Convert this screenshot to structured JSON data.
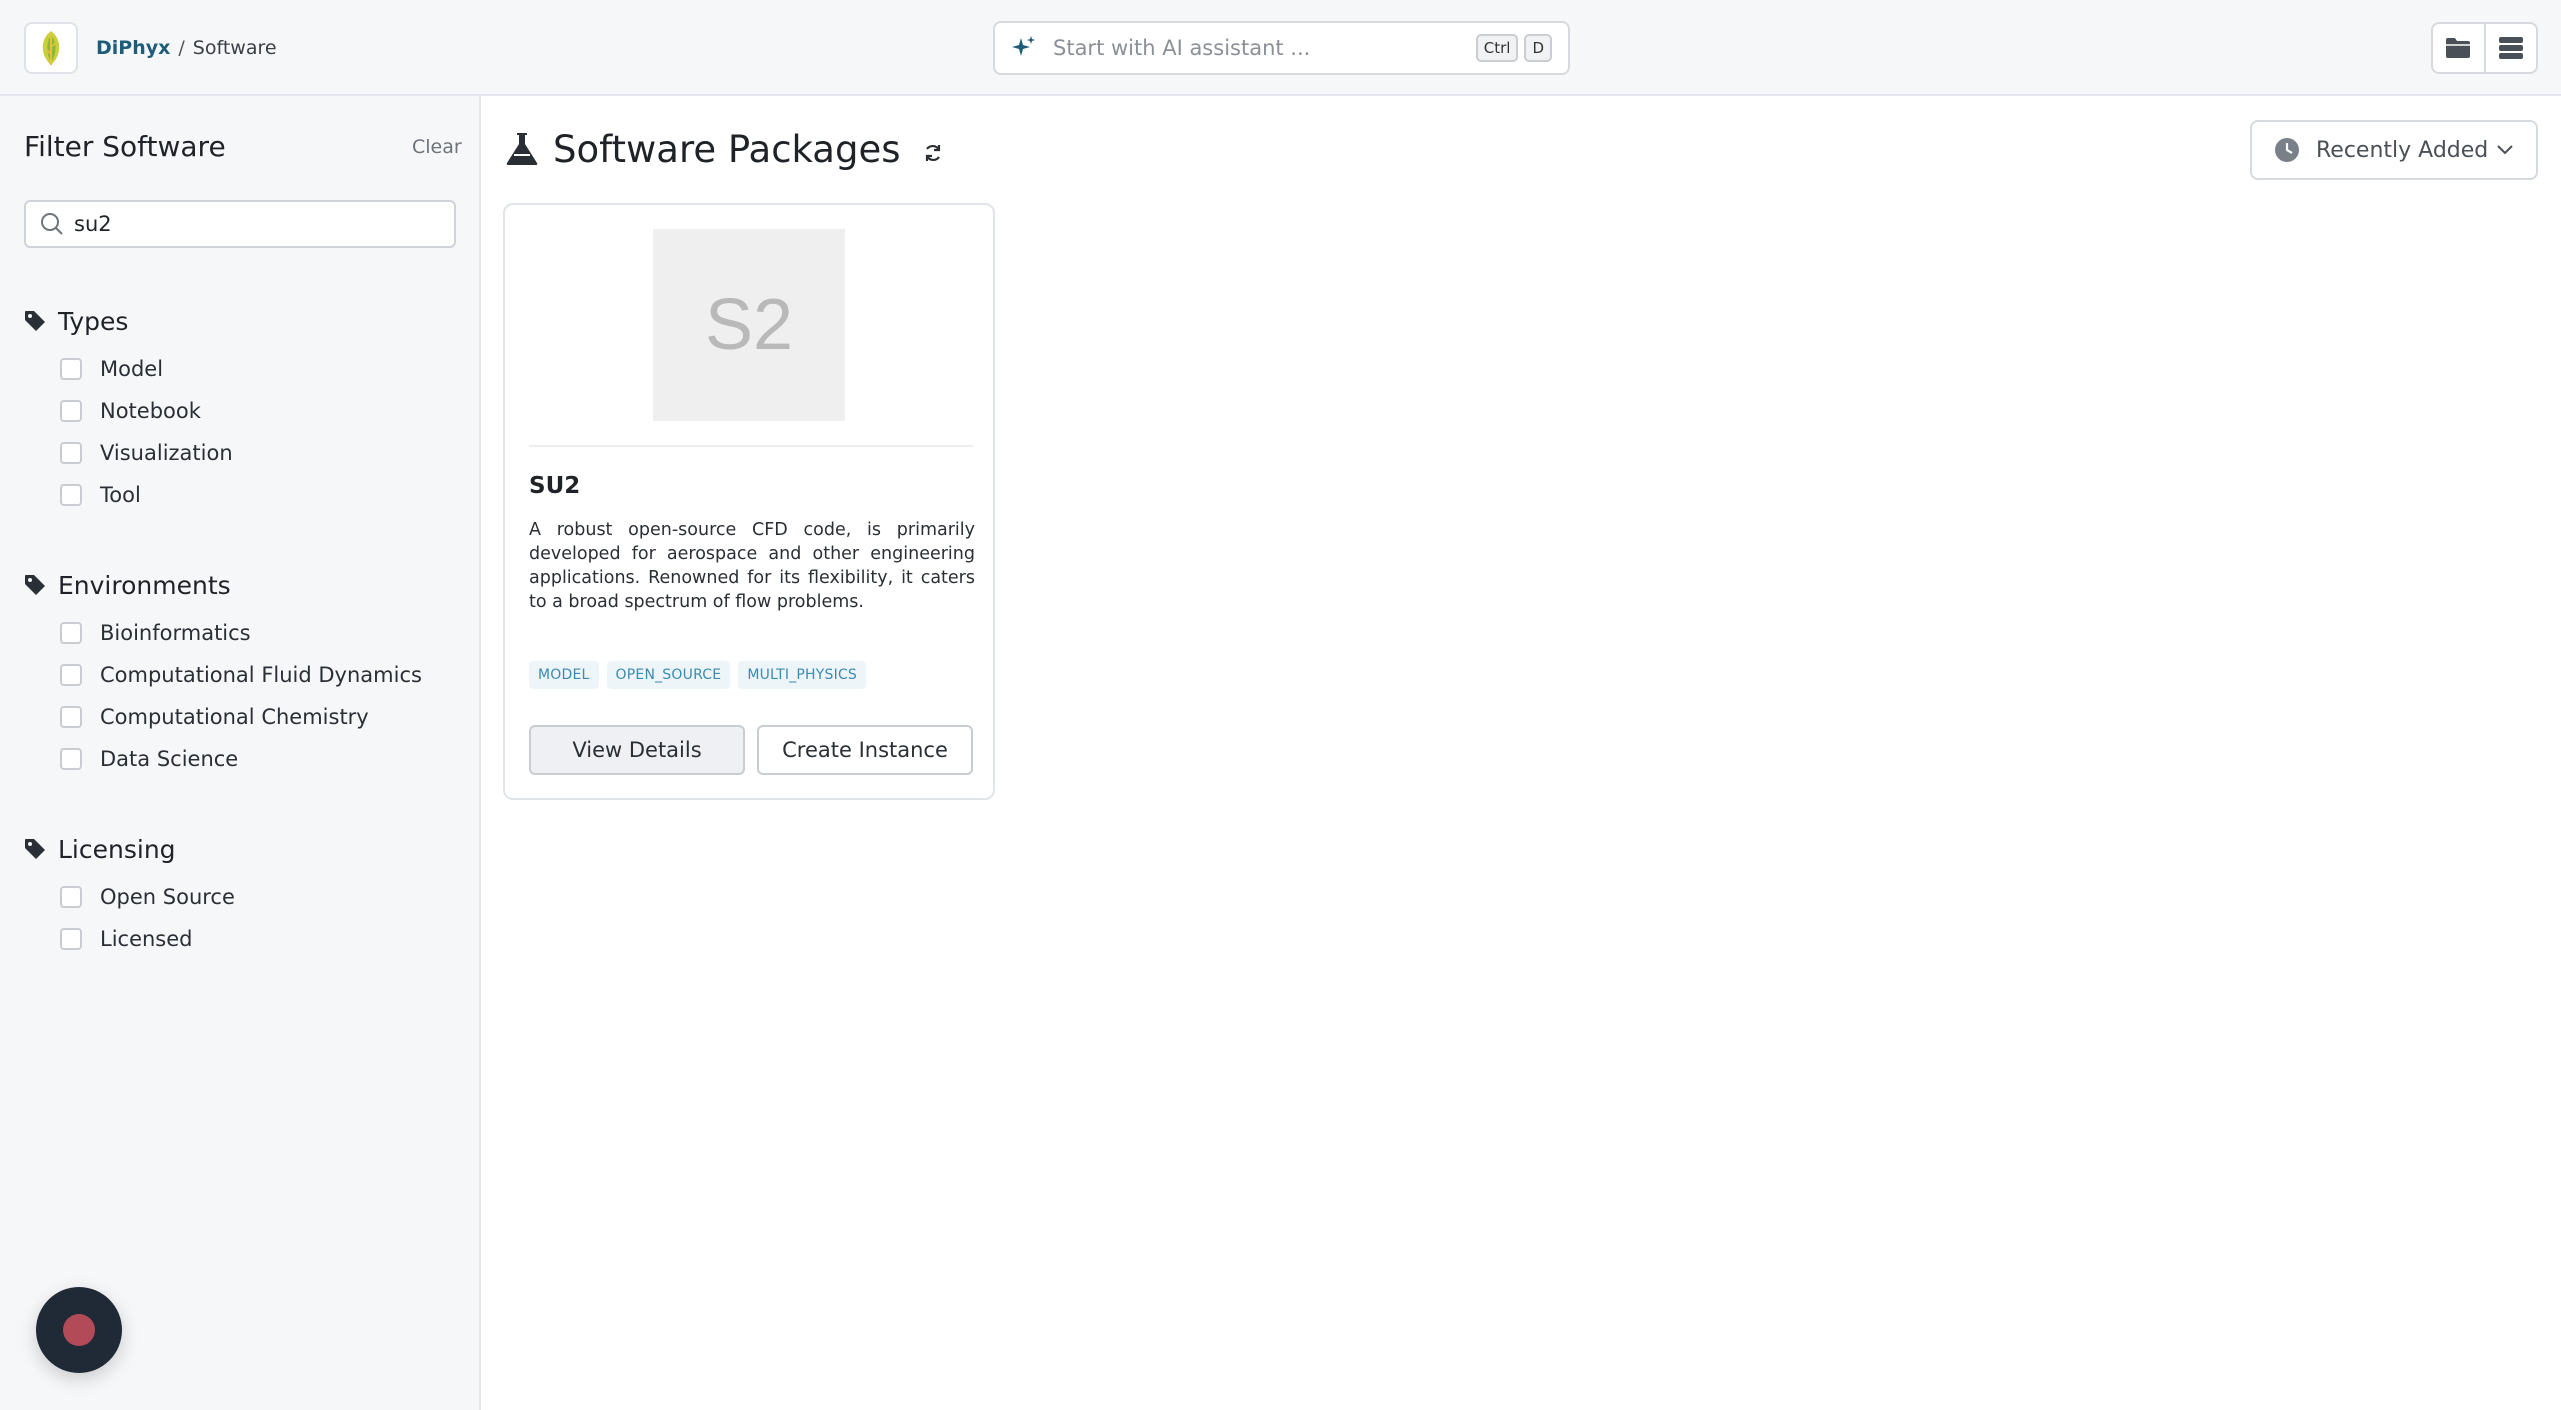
{
  "header": {
    "breadcrumb_root": "DiPhyx",
    "breadcrumb_separator": "/",
    "breadcrumb_current": "Software",
    "ai_placeholder": "Start with AI assistant ...",
    "shortcut_key1": "Ctrl",
    "shortcut_key2": "D"
  },
  "sidebar": {
    "title": "Filter Software",
    "clear_label": "Clear",
    "search_value": "su2",
    "sections": [
      {
        "title": "Types",
        "options": [
          "Model",
          "Notebook",
          "Visualization",
          "Tool"
        ]
      },
      {
        "title": "Environments",
        "options": [
          "Bioinformatics",
          "Computational Fluid Dynamics",
          "Computational Chemistry",
          "Data Science"
        ]
      },
      {
        "title": "Licensing",
        "options": [
          "Open Source",
          "Licensed"
        ]
      }
    ]
  },
  "main": {
    "title": "Software Packages",
    "sort_label": "Recently Added",
    "cards": [
      {
        "thumb_text": "S2",
        "title": "SU2",
        "description": "A robust open-source CFD code, is primarily developed for aerospace and other engineering applications. Renowned for its flexibility, it caters to a broad spectrum of flow problems.",
        "tags": [
          "MODEL",
          "OPEN_SOURCE",
          "MULTI_PHYSICS"
        ],
        "details_label": "View Details",
        "create_label": "Create Instance"
      }
    ]
  },
  "colors": {
    "brand": "#1e5d7a",
    "tag_text": "#3a8ab2",
    "tag_bg": "#eef5f9",
    "fab_bg": "#1f2a36",
    "fab_dot": "#b34a58"
  }
}
